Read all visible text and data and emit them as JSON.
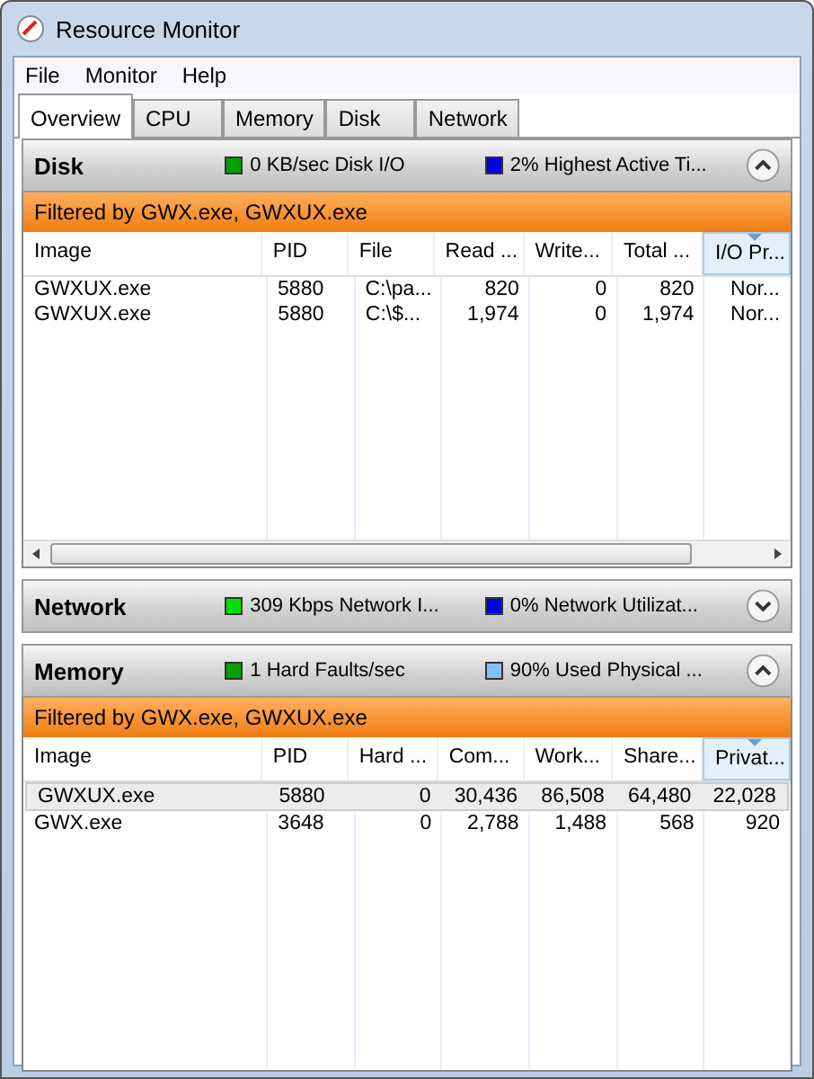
{
  "window": {
    "title": "Resource Monitor"
  },
  "menu": [
    "File",
    "Monitor",
    "Help"
  ],
  "tabs": [
    {
      "label": "Overview",
      "selected": true
    },
    {
      "label": "CPU",
      "selected": false
    },
    {
      "label": "Memory",
      "selected": false
    },
    {
      "label": "Disk",
      "selected": false
    },
    {
      "label": "Network",
      "selected": false
    }
  ],
  "sections": [
    {
      "title": "Disk",
      "expanded": true,
      "legends": [
        {
          "label": "0 KB/sec Disk I/O",
          "color": "#00a000"
        },
        {
          "label": "2% Highest Active Ti...",
          "color": "#0000e0"
        }
      ],
      "filter": "Filtered by GWX.exe, GWXUX.exe",
      "scrollbar": true,
      "table": {
        "columns": [
          {
            "label": "Image",
            "numeric": false,
            "sorted": false
          },
          {
            "label": "PID",
            "numeric": false,
            "sorted": false
          },
          {
            "label": "File",
            "numeric": false,
            "sorted": false
          },
          {
            "label": "Read ...",
            "numeric": true,
            "sorted": false
          },
          {
            "label": "Write...",
            "numeric": true,
            "sorted": false
          },
          {
            "label": "Total ...",
            "numeric": true,
            "sorted": false
          },
          {
            "label": "I/O Pr...",
            "numeric": true,
            "sorted": true
          }
        ],
        "rows": [
          {
            "selected": false,
            "cells": [
              "GWXUX.exe",
              "5880",
              "C:\\pa...",
              "820",
              "0",
              "820",
              "Nor..."
            ]
          },
          {
            "selected": false,
            "cells": [
              "GWXUX.exe",
              "5880",
              "C:\\$...",
              "1,974",
              "0",
              "1,974",
              "Nor..."
            ]
          }
        ]
      }
    },
    {
      "title": "Network",
      "expanded": false,
      "legends": [
        {
          "label": "309 Kbps Network I...",
          "color": "#00e000"
        },
        {
          "label": "0% Network Utilizat...",
          "color": "#0000e0"
        }
      ]
    },
    {
      "title": "Memory",
      "expanded": true,
      "legends": [
        {
          "label": "1 Hard Faults/sec",
          "color": "#00a000"
        },
        {
          "label": "90% Used Physical ...",
          "color": "#80c0ff"
        }
      ],
      "filter": "Filtered by GWX.exe, GWXUX.exe",
      "scrollbar": false,
      "table": {
        "columns": [
          {
            "label": "Image",
            "numeric": false,
            "sorted": false
          },
          {
            "label": "PID",
            "numeric": false,
            "sorted": false
          },
          {
            "label": "Hard ...",
            "numeric": true,
            "sorted": false
          },
          {
            "label": "Com...",
            "numeric": true,
            "sorted": false
          },
          {
            "label": "Work...",
            "numeric": true,
            "sorted": false
          },
          {
            "label": "Share...",
            "numeric": true,
            "sorted": false
          },
          {
            "label": "Privat...",
            "numeric": true,
            "sorted": true
          }
        ],
        "rows": [
          {
            "selected": true,
            "cells": [
              "GWXUX.exe",
              "5880",
              "0",
              "30,436",
              "86,508",
              "64,480",
              "22,028"
            ]
          },
          {
            "selected": false,
            "cells": [
              "GWX.exe",
              "3648",
              "0",
              "2,788",
              "1,488",
              "568",
              "920"
            ]
          }
        ]
      }
    }
  ]
}
